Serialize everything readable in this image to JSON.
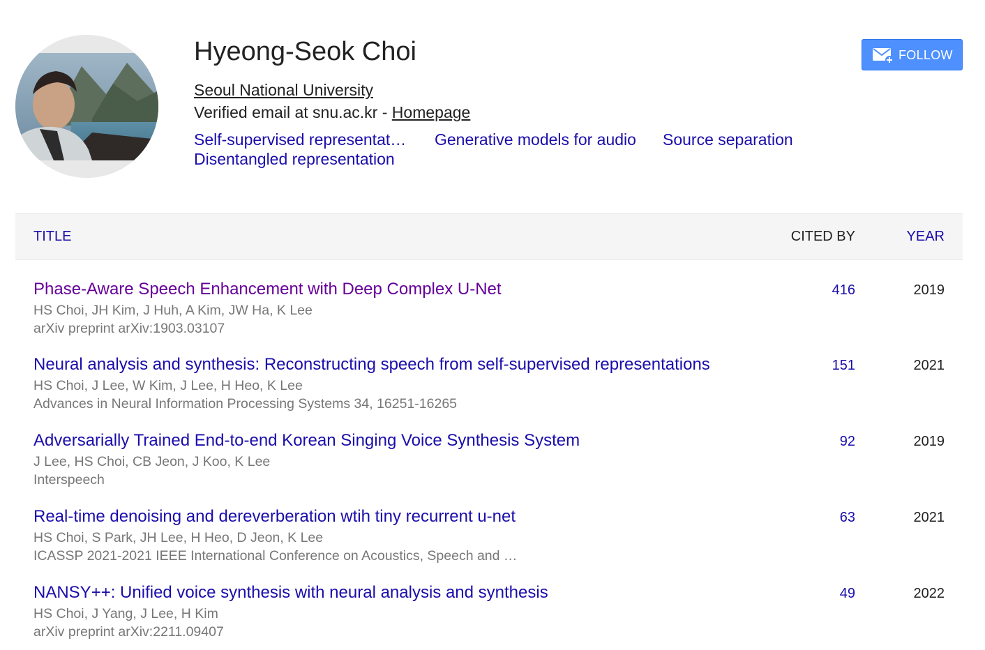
{
  "profile": {
    "name": "Hyeong-Seok Choi",
    "affiliation": "Seoul National University",
    "email_text": "Verified email at snu.ac.kr - ",
    "homepage_label": "Homepage",
    "interests": [
      "Self-supervised representat…",
      "Generative models for audio",
      "Source separation",
      "Disentangled representation"
    ],
    "follow_label": "FOLLOW"
  },
  "table": {
    "headers": {
      "title": "TITLE",
      "cited_by": "CITED BY",
      "year": "YEAR"
    },
    "rows": [
      {
        "title": "Phase-Aware Speech Enhancement with Deep Complex U-Net",
        "authors": "HS Choi, JH Kim, J Huh, A Kim, JW Ha, K Lee",
        "venue": "arXiv preprint arXiv:1903.03107",
        "cited_by": "416",
        "year": "2019"
      },
      {
        "title": "Neural analysis and synthesis: Reconstructing speech from self-supervised representations",
        "authors": "HS Choi, J Lee, W Kim, J Lee, H Heo, K Lee",
        "venue": "Advances in Neural Information Processing Systems 34, 16251-16265",
        "cited_by": "151",
        "year": "2021"
      },
      {
        "title": "Adversarially Trained End-to-end Korean Singing Voice Synthesis System",
        "authors": "J Lee, HS Choi, CB Jeon, J Koo, K Lee",
        "venue": "Interspeech",
        "cited_by": "92",
        "year": "2019"
      },
      {
        "title": "Real-time denoising and dereverberation wtih tiny recurrent u-net",
        "authors": "HS Choi, S Park, JH Lee, H Heo, D Jeon, K Lee",
        "venue": "ICASSP 2021-2021 IEEE International Conference on Acoustics, Speech and …",
        "cited_by": "63",
        "year": "2021"
      },
      {
        "title": "NANSY++: Unified voice synthesis with neural analysis and synthesis",
        "authors": "HS Choi, J Yang, J Lee, H Kim",
        "venue": "arXiv preprint arXiv:2211.09407",
        "cited_by": "49",
        "year": "2022"
      }
    ]
  },
  "colors": {
    "link": "#1a0dab",
    "visited_link": "#660099",
    "follow_button": "#4d90fe",
    "meta_text": "#777777"
  },
  "icons": {
    "follow": "envelope-plus-icon"
  }
}
